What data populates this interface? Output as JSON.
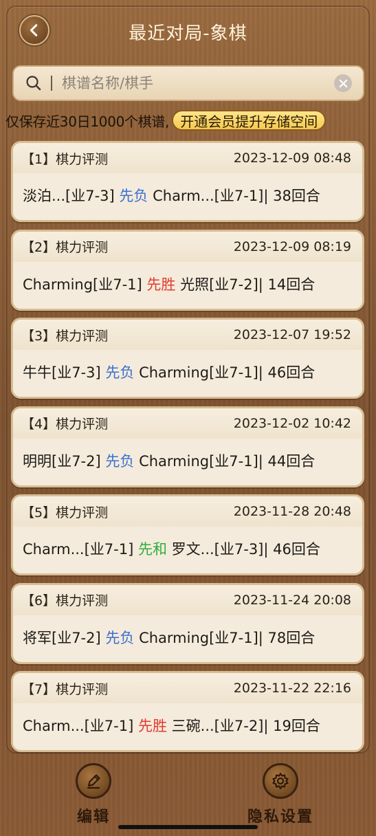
{
  "header": {
    "title": "最近对局-象棋"
  },
  "search": {
    "placeholder": "棋谱名称/棋手"
  },
  "notice": {
    "text": "仅保存近30日1000个棋谱,",
    "vip_button": "开通会员提升存储空间"
  },
  "games": [
    {
      "tag": "【1】棋力评测",
      "time": "2023-12-09 08:48",
      "p1": "淡泊...[业7-3]",
      "result": "先负",
      "result_type": "lose",
      "p2": "Charm...[业7-1]",
      "moves": "| 38回合"
    },
    {
      "tag": "【2】棋力评测",
      "time": "2023-12-09 08:19",
      "p1": "Charming[业7-1]",
      "result": "先胜",
      "result_type": "win",
      "p2": "光照[业7-2]",
      "moves": "| 14回合"
    },
    {
      "tag": "【3】棋力评测",
      "time": "2023-12-07 19:52",
      "p1": "牛牛[业7-3]",
      "result": "先负",
      "result_type": "lose",
      "p2": "Charming[业7-1]",
      "moves": "| 46回合"
    },
    {
      "tag": "【4】棋力评测",
      "time": "2023-12-02 10:42",
      "p1": "明明[业7-2]",
      "result": "先负",
      "result_type": "lose",
      "p2": "Charming[业7-1]",
      "moves": "| 44回合"
    },
    {
      "tag": "【5】棋力评测",
      "time": "2023-11-28 20:48",
      "p1": "Charm...[业7-1]",
      "result": "先和",
      "result_type": "draw",
      "p2": "罗文...[业7-3]",
      "moves": "| 46回合"
    },
    {
      "tag": "【6】棋力评测",
      "time": "2023-11-24 20:08",
      "p1": "将军[业7-2]",
      "result": "先负",
      "result_type": "lose",
      "p2": "Charming[业7-1]",
      "moves": "| 78回合"
    },
    {
      "tag": "【7】棋力评测",
      "time": "2023-11-22 22:16",
      "p1": "Charm...[业7-1]",
      "result": "先胜",
      "result_type": "win",
      "p2": "三碗...[业7-2]",
      "moves": "| 19回合"
    }
  ],
  "bottom": {
    "edit_label": "编辑",
    "privacy_label": "隐私设置"
  },
  "colors": {
    "lose": "#3a6fd0",
    "win": "#e23a2e",
    "draw": "#2eae3a"
  }
}
